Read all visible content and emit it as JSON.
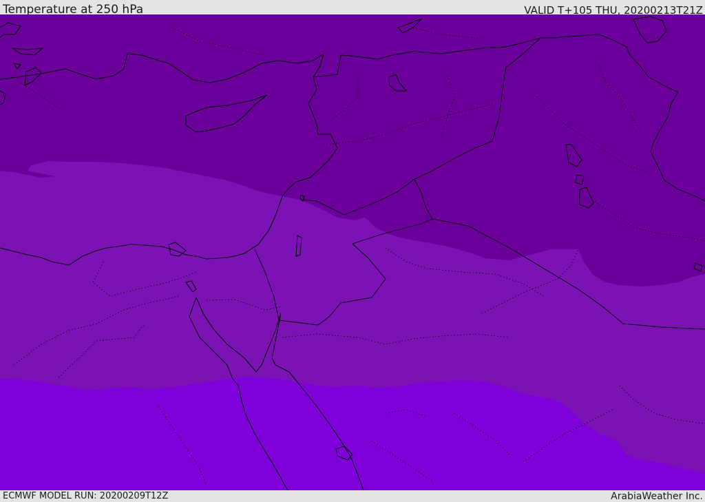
{
  "header": {
    "title": "Temperature at 250 hPa",
    "valid_time": "VALID T+105 THU, 20200213T21Z"
  },
  "footer": {
    "model_run": "ECMWF MODEL RUN: 20200209T12Z",
    "credit": "ArabiaWeather Inc."
  },
  "map": {
    "variable": "Temperature",
    "level": "250 hPa",
    "colors": {
      "band_cold": "#6a0099",
      "band_mid": "#7a12b4",
      "band_warm": "#7f00d9",
      "coastline": "#000000"
    }
  }
}
